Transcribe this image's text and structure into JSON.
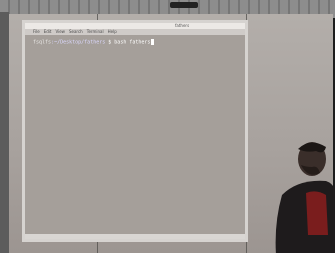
{
  "window": {
    "title": "fathers",
    "menus": [
      "File",
      "Edit",
      "View",
      "Search",
      "Terminal",
      "Help"
    ]
  },
  "terminal": {
    "prompt_user": "fsqlfs",
    "prompt_path": ":~/Desktop/fathers",
    "prompt_symbol": "$",
    "command": "bash fathers"
  }
}
